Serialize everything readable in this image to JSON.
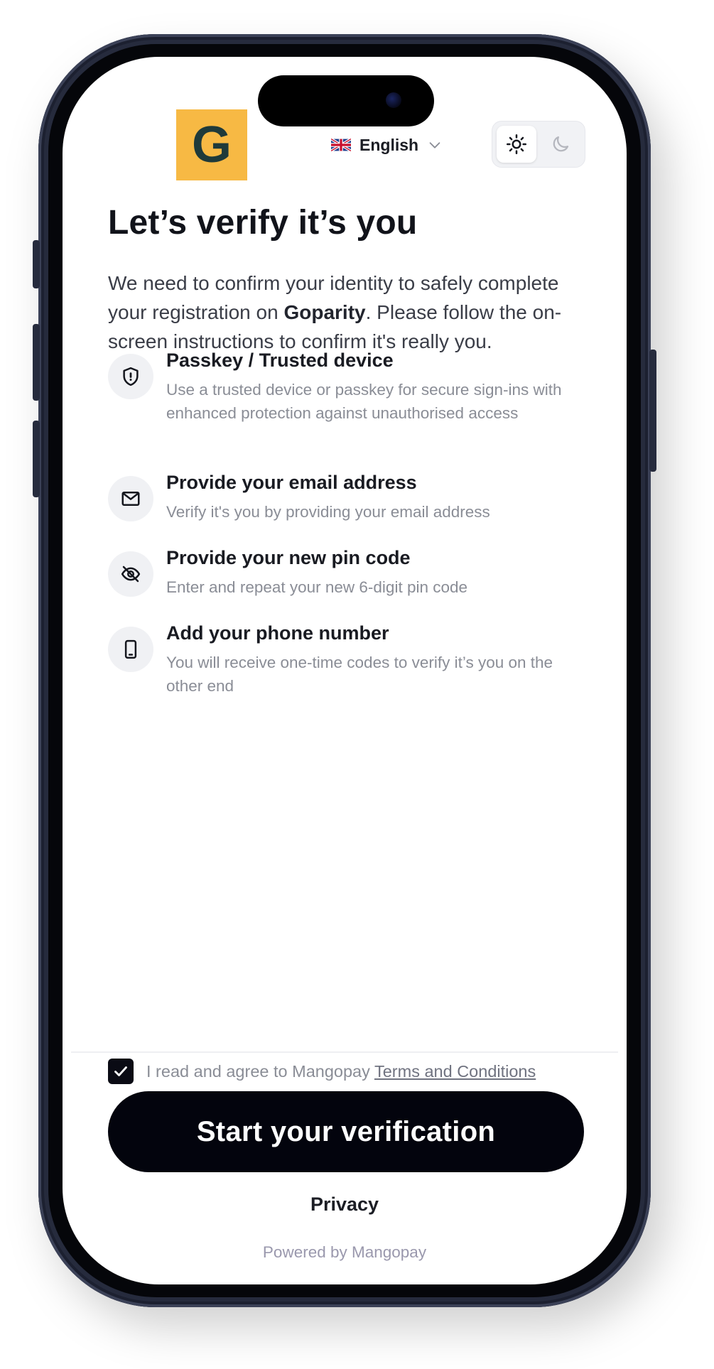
{
  "header": {
    "logo_letter": "G",
    "language": "English",
    "theme_options": [
      "light",
      "dark"
    ],
    "theme_selected": "light",
    "brand_color": "#f7b944"
  },
  "main": {
    "title": "Let’s verify it’s you",
    "intro_before": "We need to confirm your identity to safely complete your registration on ",
    "intro_brand": "Goparity",
    "intro_after": ". Please follow the on-screen instructions to confirm it's really you.",
    "steps": [
      {
        "icon": "shield-icon",
        "title": "Passkey / Trusted device",
        "description": "Use a trusted device or passkey for secure sign-ins with enhanced protection against unauthorised access"
      },
      {
        "icon": "mail-icon",
        "title": "Provide your email address",
        "description": "Verify it's you by providing your email address"
      },
      {
        "icon": "eye-off-icon",
        "title": "Provide your new pin code",
        "description": "Enter and repeat your new 6-digit pin code"
      },
      {
        "icon": "phone-icon",
        "title": "Add your phone number",
        "description": "You will receive one-time codes to verify it’s you on the other end"
      }
    ]
  },
  "footer": {
    "agree_checked": true,
    "agree_text": "I read and agree to Mangopay ",
    "terms_link": "Terms and Conditions",
    "cta_label": "Start your verification",
    "privacy_link": "Privacy",
    "powered_by": "Powered by Mangopay"
  }
}
